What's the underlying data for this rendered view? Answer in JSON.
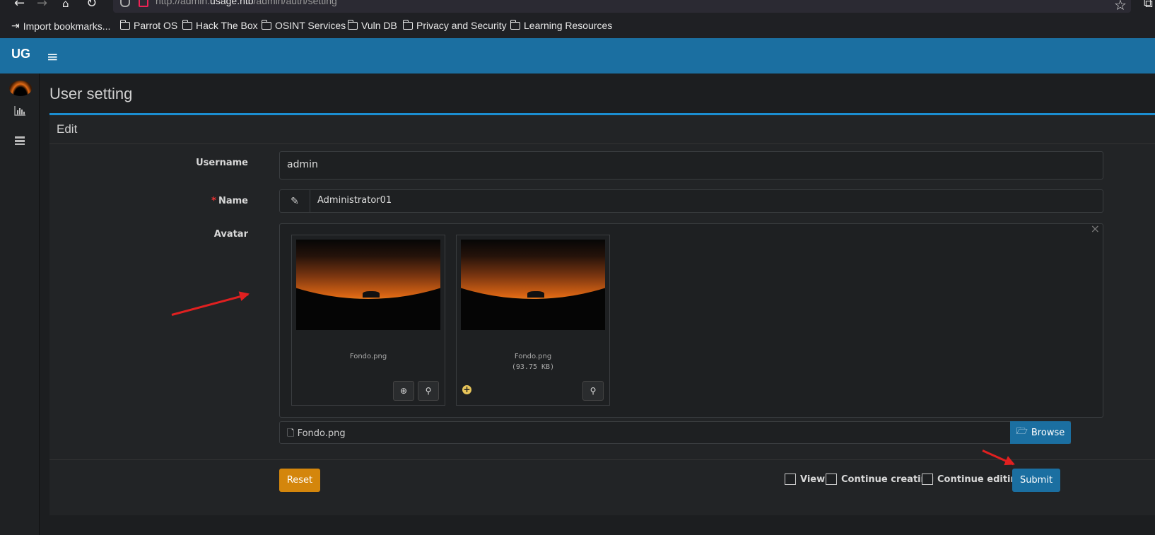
{
  "browser": {
    "url_prefix": "http://admin.",
    "url_domain": "usage.htb",
    "url_path": "/admin/auth/setting",
    "bookmarks": [
      {
        "label": "Import bookmarks...",
        "icon": "import-icon"
      },
      {
        "label": "Parrot OS",
        "icon": "folder-icon"
      },
      {
        "label": "Hack The Box",
        "icon": "folder-icon"
      },
      {
        "label": "OSINT Services",
        "icon": "folder-icon"
      },
      {
        "label": "Vuln DB",
        "icon": "folder-icon"
      },
      {
        "label": "Privacy and Security",
        "icon": "folder-icon"
      },
      {
        "label": "Learning Resources",
        "icon": "folder-icon"
      }
    ]
  },
  "app": {
    "logo": "UG",
    "accent_color": "#1b6fa1"
  },
  "page": {
    "title": "User setting",
    "box_title": "Edit"
  },
  "form": {
    "username_label": "Username",
    "username_value": "admin",
    "name_label": "Name",
    "name_required_mark": "*",
    "name_value": "Administrator01",
    "avatar_label": "Avatar",
    "avatar_files": [
      {
        "filename": "Fondo.png",
        "size": ""
      },
      {
        "filename": "Fondo.png",
        "size": "(93.75 KB)"
      }
    ],
    "file_input_value": "Fondo.png",
    "browse_label": "Browse",
    "reset_label": "Reset",
    "submit_label": "Submit",
    "after_submit_options": [
      "View",
      "Continue creating",
      "Continue editing"
    ]
  }
}
